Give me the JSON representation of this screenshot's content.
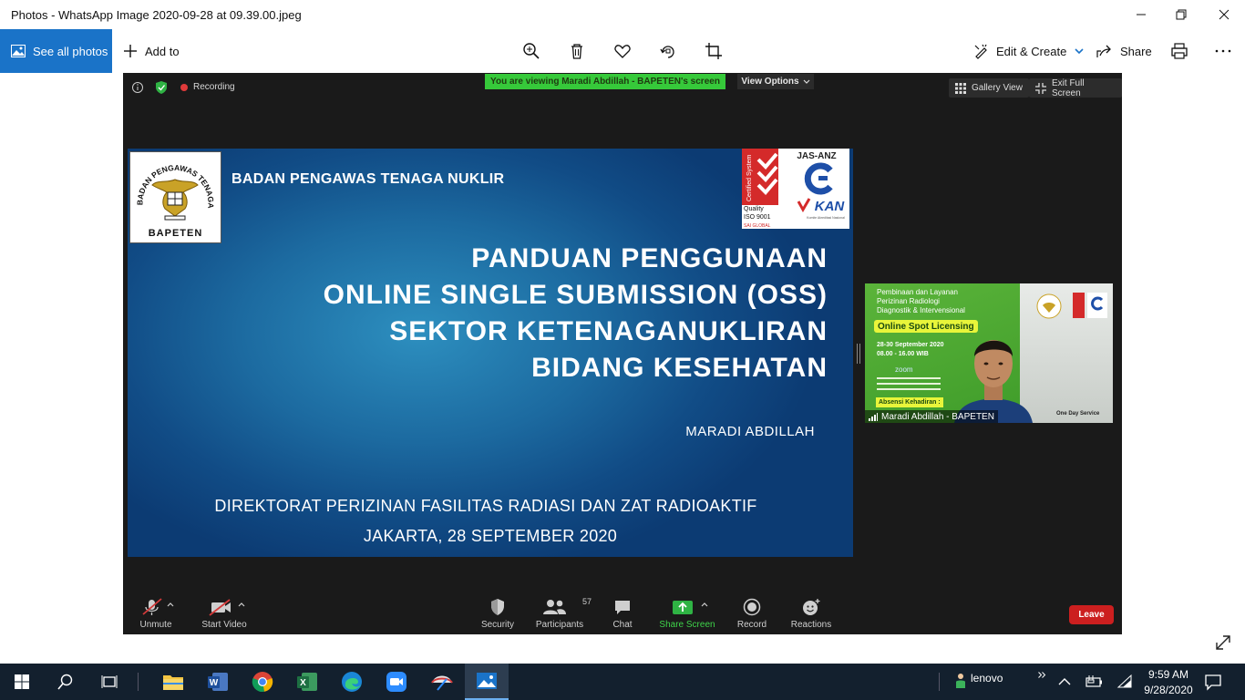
{
  "window": {
    "title": "Photos - WhatsApp Image 2020-09-28 at 09.39.00.jpeg"
  },
  "toolbar": {
    "see_all_label": "See all photos",
    "add_to_label": "Add to",
    "edit_create_label": "Edit & Create",
    "share_label": "Share"
  },
  "zoom_meeting": {
    "recording_label": "Recording",
    "viewing_banner": "You are viewing Maradi Abdillah - BAPETEN's screen",
    "view_options_label": "View Options",
    "gallery_view_label": "Gallery View",
    "exit_full_screen_label": "Exit Full Screen",
    "slide": {
      "logo_text": "BADAN PENGAWAS TENAGA NUKLIR",
      "logo_bottom": "BAPETEN",
      "organization": "BADAN PENGAWAS TENAGA NUKLIR",
      "cert": {
        "certified": "Certified System",
        "quality": "Quality",
        "iso": "ISO 9001",
        "sai": "SAI GLOBAL",
        "jas_anz": "JAS-ANZ",
        "kan": "KAN",
        "kan_sub": "Komite Akreditasi Nasional"
      },
      "title_lines": [
        "PANDUAN PENGGUNAAN",
        "ONLINE SINGLE SUBMISSION (OSS)",
        "SEKTOR KETENAGANUKLIRAN",
        "BIDANG KESEHATAN"
      ],
      "presenter": "MARADI ABDILLAH",
      "directorate": "DIREKTORAT PERIZINAN FASILITAS RADIASI DAN ZAT RADIOAKTIF",
      "place_date": "JAKARTA, 28 SEPTEMBER 2020"
    },
    "video_tile": {
      "bg_heading_1": "Pembinaan dan Layanan",
      "bg_heading_2": "Perizinan Radiologi",
      "bg_heading_3": "Diagnostik & Intervensional",
      "bg_badge": "Online Spot Licensing",
      "bg_dates": "28-30 September 2020",
      "bg_time": "08.00 - 16.00 WIB",
      "bg_zoom": "zoom",
      "bg_attendance": "Absensi Kehadiran :",
      "bg_service": "One Day Service",
      "participant_name": "Maradi Abdillah - BAPETEN"
    },
    "controls": {
      "unmute": "Unmute",
      "start_video": "Start Video",
      "security": "Security",
      "participants": "Participants",
      "participants_count": "57",
      "chat": "Chat",
      "share_screen": "Share Screen",
      "record": "Record",
      "reactions": "Reactions",
      "leave": "Leave"
    }
  },
  "taskbar": {
    "user": "lenovo",
    "time": "9:59 AM",
    "date": "9/28/2020"
  },
  "colors": {
    "accent_blue": "#1a73c8",
    "zoom_green": "#36c93a",
    "leave_red": "#cc1f1f",
    "taskbar": "#13202e"
  }
}
